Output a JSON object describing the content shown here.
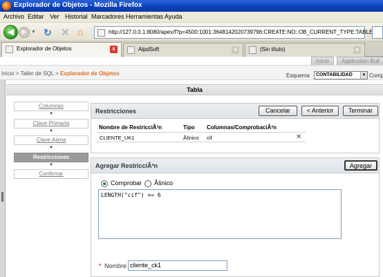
{
  "window": {
    "title": "Explorador de Objetos - Mozilla Firefox"
  },
  "menu": [
    "Archivo",
    "Editar",
    "Ver",
    "Historial",
    "Marcadores",
    "Herramientas",
    "Ayuda"
  ],
  "nav": {
    "url": "http://127.0.0.1:8080/apex/f?p=4500:1001:3648142020739796:CREATE:NO::OB_CURRENT_TYPE:TABLE"
  },
  "tabs": [
    {
      "label": "Explorador de Objetos",
      "active": true
    },
    {
      "label": "AlpdSoft",
      "active": false
    },
    {
      "label": "(Sin título)",
      "active": false
    }
  ],
  "apex_tabs": [
    "Inicio",
    "Application Buil"
  ],
  "breadcrumb": {
    "part1": "Inicio",
    "sep": " > ",
    "part2": "Taller de SQL",
    "current": "Explorador de Objetos"
  },
  "schema": {
    "label": "Esquema",
    "value": "CONTABILIDAD",
    "next_label": "Comp"
  },
  "region_title": "Tabla",
  "wizard": {
    "steps": [
      {
        "label": "Columnas",
        "current": false
      },
      {
        "label": "Clave Primaria",
        "current": false
      },
      {
        "label": "Clave Ajena",
        "current": false
      },
      {
        "label": "Restricciones",
        "current": true
      },
      {
        "label": "Confirmar",
        "current": false
      }
    ],
    "arrow": "▼"
  },
  "restricciones": {
    "title": "Restricciones",
    "buttons": {
      "cancel": "Cancelar",
      "prev": "< Anterior",
      "finish": "Terminar"
    },
    "columns": [
      "Nombre de RestricciÃ³n",
      "Tipo",
      "Columnas/ComprobaciÃ³n"
    ],
    "rows": [
      {
        "name": "CLIENTE_UK1",
        "type": "Ãšnico",
        "cols": "cif"
      }
    ],
    "delete_symbol": "✕"
  },
  "agregar": {
    "title": "Agregar RestricciÃ³n",
    "add_button": "Agregar",
    "options": [
      {
        "label": "Comprobar",
        "selected": true
      },
      {
        "label": "Ãšnico",
        "selected": false
      }
    ],
    "condition": "LENGTH(\"cif\") >= 6",
    "required_mark": "*",
    "name_label": "Nombre",
    "name_value": "cliente_ck1"
  }
}
